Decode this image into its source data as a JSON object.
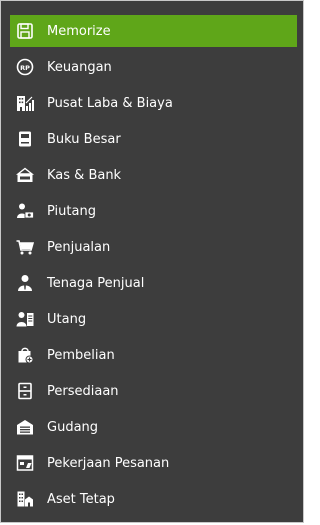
{
  "menu": {
    "colors": {
      "panel_bg": "#3d3d3d",
      "active_bg": "#5fa619",
      "text": "#ffffff",
      "icon": "#ffffff"
    },
    "items": [
      {
        "label": "Memorize",
        "icon": "floppy-disk-icon",
        "active": true
      },
      {
        "label": "Keuangan",
        "icon": "rupiah-coin-icon",
        "active": false
      },
      {
        "label": "Pusat Laba & Biaya",
        "icon": "building-chart-icon",
        "active": false
      },
      {
        "label": "Buku Besar",
        "icon": "ledger-book-icon",
        "active": false
      },
      {
        "label": "Kas & Bank",
        "icon": "cash-envelope-icon",
        "active": false
      },
      {
        "label": "Piutang",
        "icon": "person-money-icon",
        "active": false
      },
      {
        "label": "Penjualan",
        "icon": "shopping-cart-icon",
        "active": false
      },
      {
        "label": "Tenaga Penjual",
        "icon": "salesperson-icon",
        "active": false
      },
      {
        "label": "Utang",
        "icon": "person-document-icon",
        "active": false
      },
      {
        "label": "Pembelian",
        "icon": "shopping-bag-icon",
        "active": false
      },
      {
        "label": "Persediaan",
        "icon": "storage-cabinet-icon",
        "active": false
      },
      {
        "label": "Gudang",
        "icon": "warehouse-icon",
        "active": false
      },
      {
        "label": "Pekerjaan Pesanan",
        "icon": "job-order-icon",
        "active": false
      },
      {
        "label": "Aset Tetap",
        "icon": "buildings-icon",
        "active": false
      }
    ]
  }
}
